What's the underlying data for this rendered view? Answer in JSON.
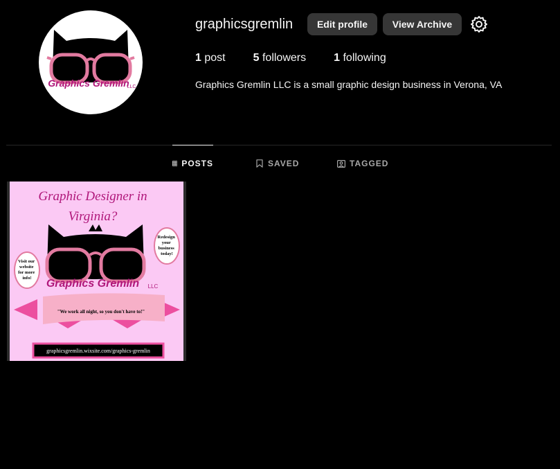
{
  "profile": {
    "username": "graphicsgremlin",
    "avatar_text": "Graphics Gremlin",
    "avatar_llc": "LLC",
    "bio": "Graphics Gremlin LLC is a small graphic design business in Verona, VA"
  },
  "actions": {
    "edit_label": "Edit profile",
    "archive_label": "View Archive",
    "settings_icon": "gear-icon"
  },
  "stats": {
    "posts_count": "1",
    "posts_label": "post",
    "followers_count": "5",
    "followers_label": "followers",
    "following_count": "1",
    "following_label": "following"
  },
  "tabs": [
    {
      "label": "POSTS",
      "icon": "grid-icon",
      "active": true
    },
    {
      "label": "SAVED",
      "icon": "bookmark-icon",
      "active": false
    },
    {
      "label": "TAGGED",
      "icon": "tag-icon",
      "active": false
    }
  ],
  "post": {
    "headline_line1": "Graphic Designer in",
    "headline_line2": "Virginia?",
    "left_bubble": [
      "Visit our",
      "website",
      "for more",
      "info!"
    ],
    "right_bubble": [
      "Redesign",
      "your",
      "business",
      "today!"
    ],
    "brand": "Graphics Gremlin",
    "brand_llc": "LLC",
    "banner": "\"We work all night, so you don't have to!\"",
    "url": "graphicsgremlin.wixsite.com/graphics-gremlin"
  },
  "colors": {
    "background": "#000000",
    "button": "#363636",
    "tab_inactive": "#a8a8a8",
    "brand_pink": "#e27aa0",
    "brand_magenta": "#b0177a",
    "poster_bg": "#fbc9f4"
  }
}
